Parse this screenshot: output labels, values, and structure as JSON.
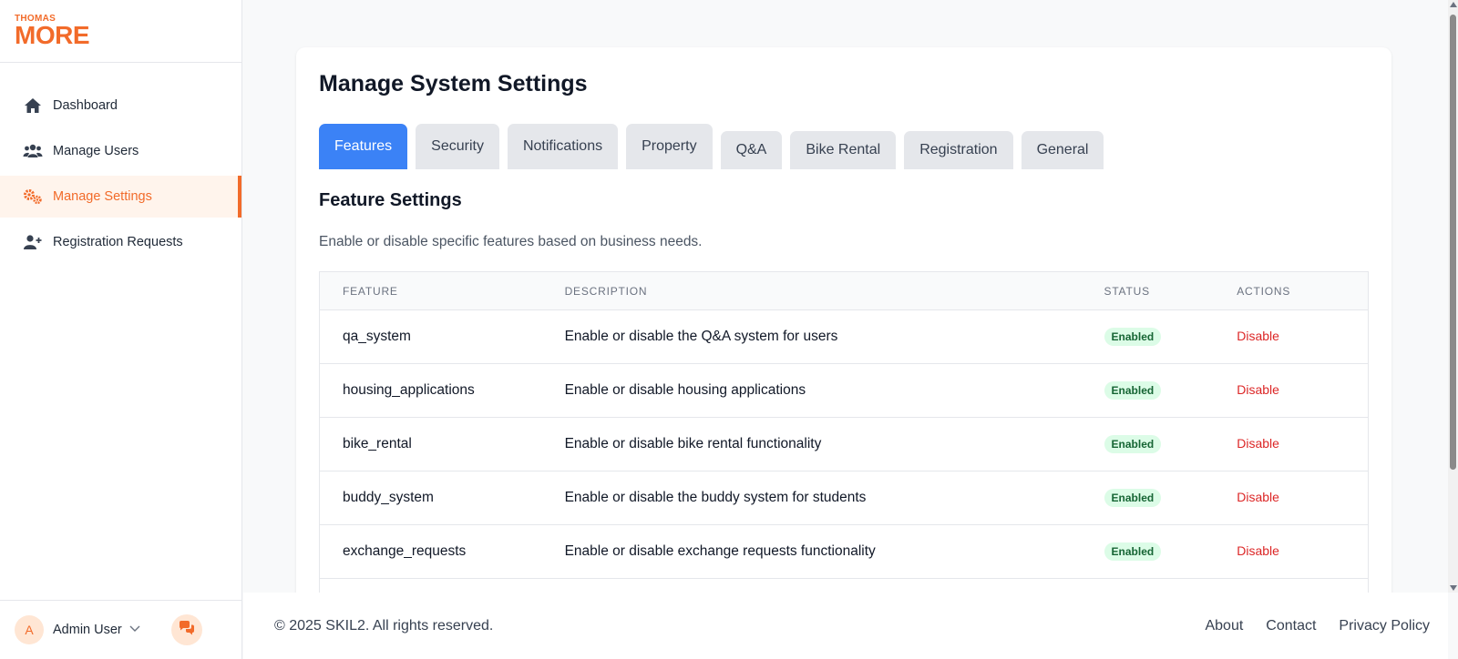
{
  "brand": {
    "line1": "THOMAS",
    "line2": "MORE",
    "color": "#f26b2a"
  },
  "sidebar": {
    "items": [
      {
        "label": "Dashboard",
        "icon": "home-icon",
        "active": false
      },
      {
        "label": "Manage Users",
        "icon": "users-icon",
        "active": false
      },
      {
        "label": "Manage Settings",
        "icon": "gears-icon",
        "active": true
      },
      {
        "label": "Registration Requests",
        "icon": "user-plus-icon",
        "active": false
      }
    ],
    "user": {
      "initial": "A",
      "name": "Admin User"
    }
  },
  "main": {
    "title": "Manage System Settings",
    "tabs": [
      {
        "label": "Features",
        "active": true
      },
      {
        "label": "Security"
      },
      {
        "label": "Notifications"
      },
      {
        "label": "Property"
      },
      {
        "label": "Q&A"
      },
      {
        "label": "Bike Rental"
      },
      {
        "label": "Registration"
      },
      {
        "label": "General"
      }
    ],
    "section_title": "Feature Settings",
    "section_desc": "Enable or disable specific features based on business needs.",
    "table": {
      "headers": [
        "FEATURE",
        "DESCRIPTION",
        "STATUS",
        "ACTIONS"
      ],
      "rows": [
        {
          "feature": "qa_system",
          "description": "Enable or disable the Q&A system for users",
          "status": "Enabled",
          "action": "Disable"
        },
        {
          "feature": "housing_applications",
          "description": "Enable or disable housing applications",
          "status": "Enabled",
          "action": "Disable"
        },
        {
          "feature": "bike_rental",
          "description": "Enable or disable bike rental functionality",
          "status": "Enabled",
          "action": "Disable"
        },
        {
          "feature": "buddy_system",
          "description": "Enable or disable the buddy system for students",
          "status": "Enabled",
          "action": "Disable"
        },
        {
          "feature": "exchange_requests",
          "description": "Enable or disable exchange requests functionality",
          "status": "Enabled",
          "action": "Disable"
        }
      ]
    }
  },
  "footer": {
    "copyright": "© 2025 SKIL2. All rights reserved.",
    "links": [
      "About",
      "Contact",
      "Privacy Policy"
    ]
  },
  "colors": {
    "accent": "#f26b2a",
    "tab_active": "#3b82f6",
    "danger": "#dc2626",
    "success_bg": "#dcfce7",
    "success_text": "#166534"
  }
}
